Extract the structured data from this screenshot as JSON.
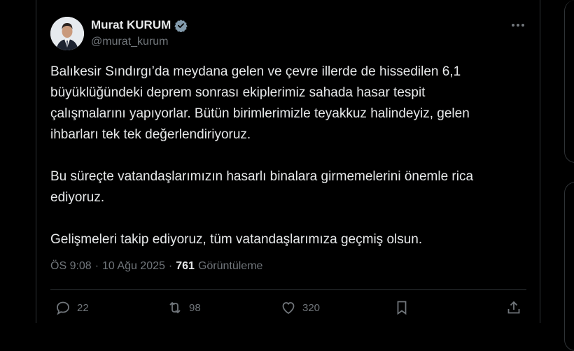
{
  "author": {
    "display_name": "Murat KURUM",
    "handle": "@murat_kurum",
    "verified_badge_color": "#829aab"
  },
  "tweet": {
    "paragraphs": [
      "Balıkesir Sındırgı’da meydana gelen ve çevre illerde de hissedilen 6,1\nbüyüklüğündeki deprem sonrası ekiplerimiz sahada hasar tespit\nçalışmalarını yapıyorlar. Bütün birimlerimizle teyakkuz halindeyiz, gelen\nihbarları tek tek değerlendiriyoruz.",
      "Bu süreçte vatandaşlarımızın hasarlı binalara girmemelerini önemle rica\nediyoruz.",
      "Gelişmeleri takip ediyoruz, tüm vatandaşlarımıza geçmiş olsun."
    ]
  },
  "meta": {
    "time": "ÖS 9:08",
    "separator": "·",
    "date": "10 Ağu 2025",
    "views_count": "761",
    "views_label": "Görüntüleme"
  },
  "actions": {
    "reply_count": "22",
    "retweet_count": "98",
    "like_count": "320"
  },
  "icons": [
    "verified-icon",
    "more-icon",
    "reply-icon",
    "retweet-icon",
    "like-icon",
    "bookmark-icon",
    "share-icon"
  ]
}
